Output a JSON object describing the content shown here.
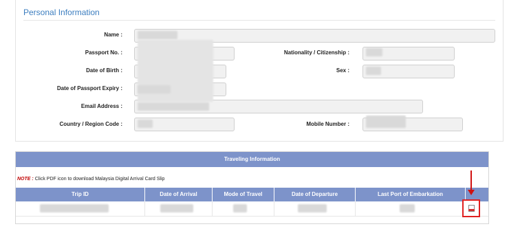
{
  "personal": {
    "title": "Personal Information",
    "labels": {
      "name": "Name :",
      "passport_no": "Passport No. :",
      "dob": "Date of Birth :",
      "passport_expiry": "Date of Passport Expiry :",
      "email": "Email Address :",
      "country_code": "Country / Region Code :",
      "nationality": "Nationality / Citizenship :",
      "sex": "Sex :",
      "mobile": "Mobile Number :"
    }
  },
  "travel": {
    "title": "Traveling Information",
    "note_key": "NOTE :",
    "note_text": "Click PDF icon to download Malaysia Digital Arrival Card Slip",
    "columns": [
      "Trip ID",
      "Date of Arrival",
      "Mode of Travel",
      "Date of Departure",
      "Last Port of Embarkation",
      ""
    ]
  },
  "icons": {
    "pdf": "pdf-icon",
    "annotation_arrow": "red-arrow"
  },
  "colors": {
    "section_title": "#3b7dbf",
    "table_header": "#7d93ca",
    "note": "#c00000",
    "highlight": "#e02020"
  }
}
